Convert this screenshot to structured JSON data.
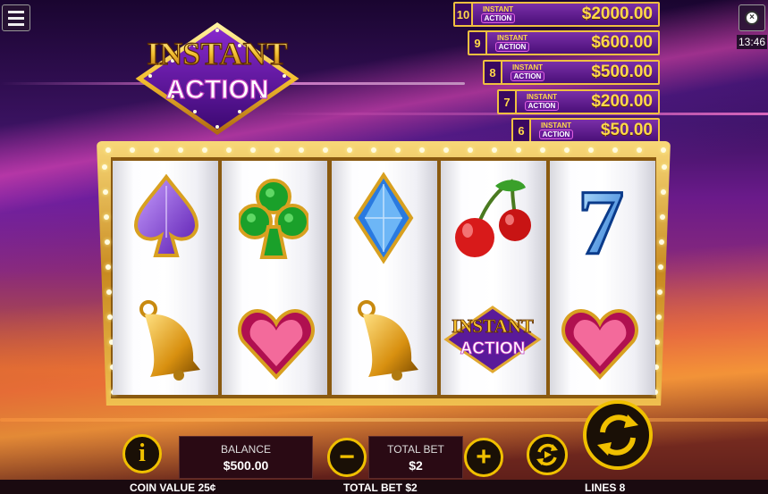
{
  "clock": {
    "time": "13:46"
  },
  "logo": {
    "line1": "INSTANT",
    "line2": "ACTION"
  },
  "jackpots": [
    {
      "num": "10",
      "badge1": "INSTANT",
      "badge2": "ACTION",
      "amount": "$2000.00"
    },
    {
      "num": "9",
      "badge1": "INSTANT",
      "badge2": "ACTION",
      "amount": "$600.00"
    },
    {
      "num": "8",
      "badge1": "INSTANT",
      "badge2": "ACTION",
      "amount": "$500.00"
    },
    {
      "num": "7",
      "badge1": "INSTANT",
      "badge2": "ACTION",
      "amount": "$200.00"
    },
    {
      "num": "6",
      "badge1": "INSTANT",
      "badge2": "ACTION",
      "amount": "$50.00"
    }
  ],
  "reels": [
    {
      "top": "spade-symbol",
      "bottom": "bell-symbol"
    },
    {
      "top": "club-symbol",
      "bottom": "heart-symbol"
    },
    {
      "top": "diamond-symbol",
      "bottom": "bell-symbol"
    },
    {
      "top": "cherry-symbol",
      "bottom": "instant-action-symbol"
    },
    {
      "top": "seven-symbol",
      "bottom": "heart-symbol"
    }
  ],
  "symbol_text": {
    "line1": "INSTANT",
    "line2": "ACTION",
    "seven": "7"
  },
  "controls": {
    "info_label": "i",
    "balance_label": "BALANCE",
    "balance_value": "$500.00",
    "minus_label": "−",
    "total_bet_label": "TOTAL BET",
    "total_bet_value": "$2",
    "plus_label": "+"
  },
  "status": {
    "coin_value": "COIN VALUE 25¢",
    "total_bet": "TOTAL BET $2",
    "lines": "LINES 8"
  },
  "colors": {
    "gold": "#f0c000",
    "jackpot_bg": "#5a1a8a",
    "jackpot_text": "#ffd84a"
  }
}
